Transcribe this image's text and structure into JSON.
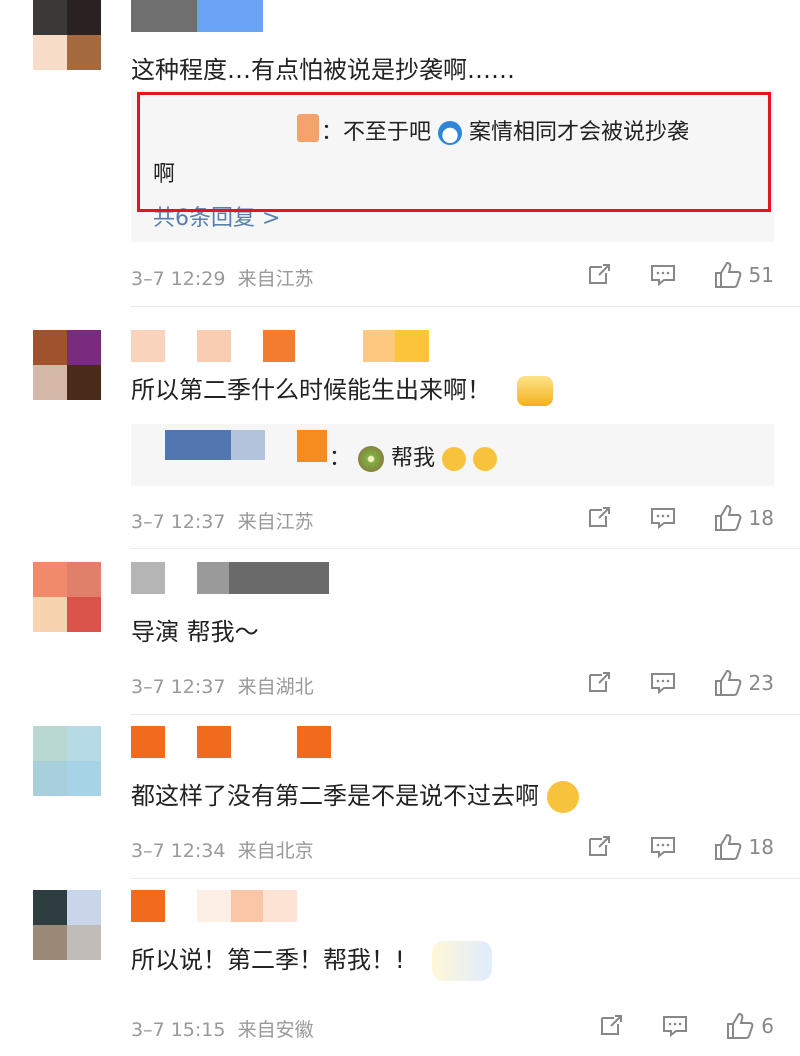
{
  "comments": [
    {
      "text": "这种程度…有点怕被说是抄袭啊……",
      "reply": {
        "text_line1": "：不至于吧",
        "text_line1b": "案情相同才会被说抄袭",
        "text_line2": "啊",
        "more": "共6条回复 >"
      },
      "date": "3–7 12:29",
      "source": "来自江苏",
      "likes": "51"
    },
    {
      "text": "所以第二季什么时候能生出来啊！",
      "reply": {
        "text_prefix": "：",
        "text": "帮我"
      },
      "date": "3–7 12:37",
      "source": "来自江苏",
      "likes": "18"
    },
    {
      "text": "导演 帮我～",
      "date": "3–7 12:37",
      "source": "来自湖北",
      "likes": "23"
    },
    {
      "text": "都这样了没有第二季是不是说不过去啊",
      "date": "3–7 12:34",
      "source": "来自北京",
      "likes": "18"
    },
    {
      "text": "所以说！第二季！帮我！!",
      "date": "3–7 15:15",
      "source": "来自安徽",
      "likes": "6"
    }
  ],
  "colors": {
    "highlight_border": "#e8141c",
    "link": "#5a7fae",
    "meta": "#999999",
    "reply_bg": "#f6f6f6"
  },
  "icons": [
    "share-icon",
    "comment-icon",
    "like-icon",
    "badge-emoji",
    "kiwi-emoji",
    "crying-emoji",
    "sticker"
  ]
}
